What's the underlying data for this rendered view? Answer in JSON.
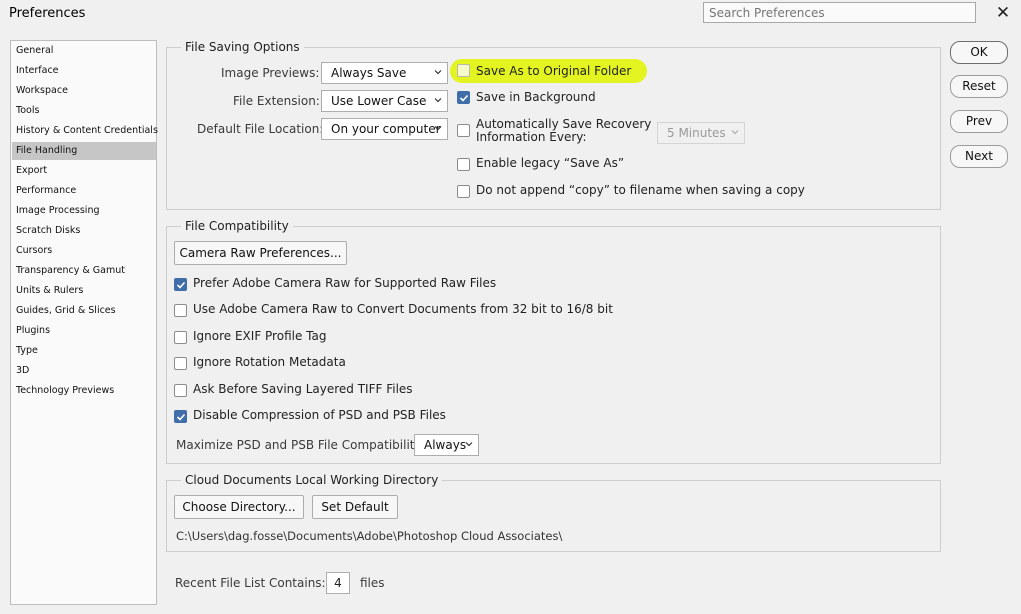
{
  "window": {
    "title": "Preferences",
    "search_placeholder": "Search Preferences"
  },
  "sidebar": {
    "items": [
      {
        "label": "General"
      },
      {
        "label": "Interface"
      },
      {
        "label": "Workspace"
      },
      {
        "label": "Tools"
      },
      {
        "label": "History & Content Credentials"
      },
      {
        "label": "File Handling",
        "selected": true
      },
      {
        "label": "Export"
      },
      {
        "label": "Performance"
      },
      {
        "label": "Image Processing"
      },
      {
        "label": "Scratch Disks"
      },
      {
        "label": "Cursors"
      },
      {
        "label": "Transparency & Gamut"
      },
      {
        "label": "Units & Rulers"
      },
      {
        "label": "Guides, Grid & Slices"
      },
      {
        "label": "Plugins"
      },
      {
        "label": "Type"
      },
      {
        "label": "3D"
      },
      {
        "label": "Technology Previews"
      }
    ]
  },
  "file_saving": {
    "title": "File Saving Options",
    "image_previews": {
      "label": "Image Previews:",
      "value": "Always Save"
    },
    "file_extension": {
      "label": "File Extension:",
      "value": "Use Lower Case"
    },
    "default_location": {
      "label": "Default File Location:",
      "value": "On your computer"
    },
    "save_original": {
      "label": "Save As to Original Folder",
      "checked": false
    },
    "save_background": {
      "label": "Save in Background",
      "checked": true
    },
    "auto_recovery": {
      "label_line1": "Automatically Save Recovery",
      "label_line2": "Information Every:",
      "checked": false,
      "interval": "5 Minutes"
    },
    "legacy_save_as": {
      "label": "Enable legacy “Save As”",
      "checked": false
    },
    "no_copy": {
      "label": "Do not append “copy” to filename when saving a copy",
      "checked": false
    }
  },
  "compat": {
    "title": "File Compatibility",
    "camera_raw_button": "Camera Raw Preferences...",
    "prefer_acr": {
      "label": "Prefer Adobe Camera Raw for Supported Raw Files",
      "checked": true
    },
    "use_acr_convert": {
      "label": "Use Adobe Camera Raw to Convert Documents from 32 bit to 16/8 bit",
      "checked": false
    },
    "ignore_exif": {
      "label": "Ignore EXIF Profile Tag",
      "checked": false
    },
    "ignore_rotation": {
      "label": "Ignore Rotation Metadata",
      "checked": false
    },
    "ask_tiff": {
      "label": "Ask Before Saving Layered TIFF Files",
      "checked": false
    },
    "disable_compression": {
      "label": "Disable Compression of PSD and PSB Files",
      "checked": true
    },
    "maximize": {
      "label": "Maximize PSD and PSB File Compatibility:",
      "value": "Always"
    }
  },
  "cloud": {
    "title": "Cloud Documents Local Working Directory",
    "choose_button": "Choose Directory...",
    "default_button": "Set Default",
    "path": "C:\\Users\\dag.fosse\\Documents\\Adobe\\Photoshop Cloud Associates\\"
  },
  "recent": {
    "label": "Recent File List Contains:",
    "value": "4",
    "suffix": "files"
  },
  "buttons": {
    "ok": "OK",
    "reset": "Reset",
    "prev": "Prev",
    "next": "Next"
  },
  "colors": {
    "highlight": "#e3f421",
    "checkbox_checked": "#3f6ea9",
    "selected_nav": "#c6c6c6"
  }
}
